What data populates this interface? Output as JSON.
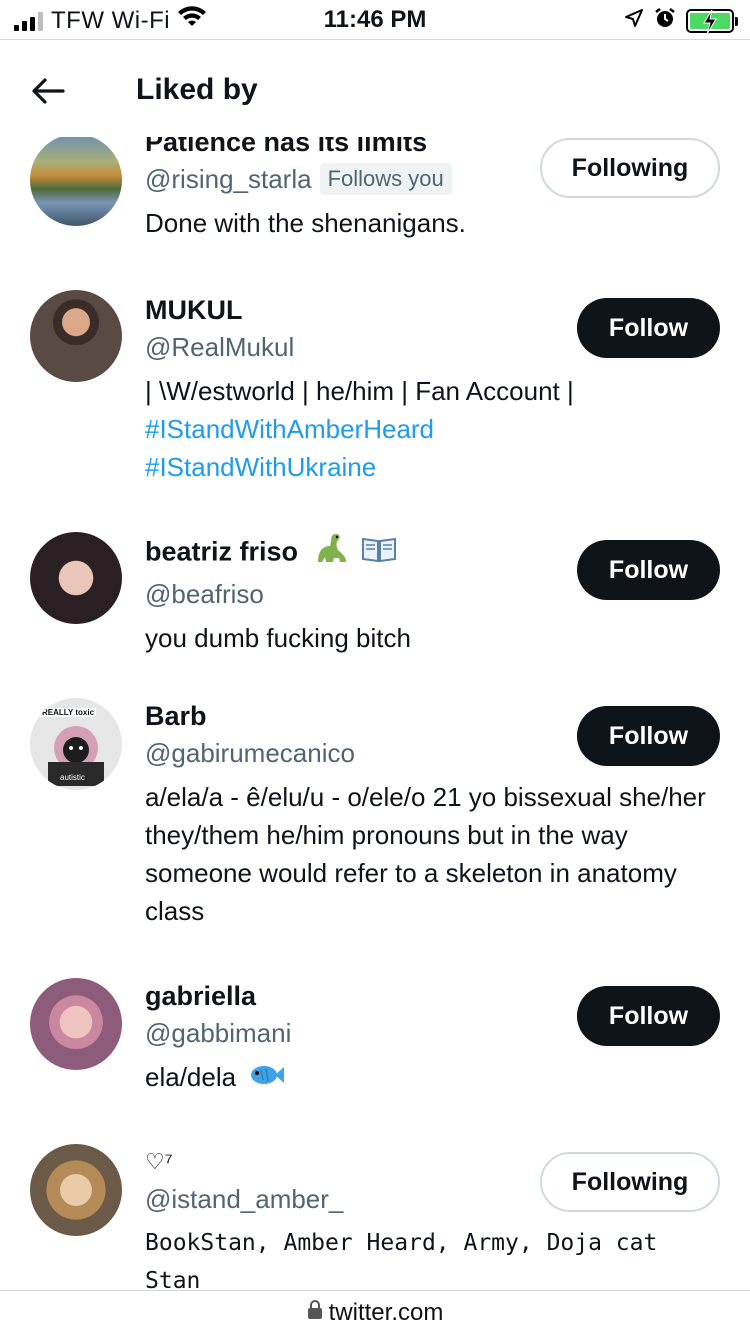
{
  "status_bar": {
    "carrier": "TFW Wi-Fi",
    "time": "11:46 PM"
  },
  "header": {
    "title": "Liked by"
  },
  "users": [
    {
      "name": "Patience has its limits",
      "handle": "@rising_starla",
      "badge": "Follows you",
      "bio": "Done with the shenanigans.",
      "button": "Following"
    },
    {
      "name": "MUKUL",
      "handle": "@RealMukul",
      "bio": "| \\W/estworld | he/him | Fan Account |",
      "tags": [
        "#IStandWithAmberHeard",
        "#IStandWithUkraine"
      ],
      "button": "Follow"
    },
    {
      "name": "beatriz friso",
      "handle": "@beafriso",
      "bio": "you dumb fucking bitch",
      "button": "Follow"
    },
    {
      "name": "Barb",
      "handle": "@gabirumecanico",
      "bio": "a/ela/a - ê/elu/u - o/ele/o 21 yo bissexual she/her they/them he/him pronouns but in the way someone would refer to a skeleton in anatomy class",
      "avatar_text": [
        "REALLY toxic",
        "autistic"
      ],
      "button": "Follow"
    },
    {
      "name": "gabriella",
      "handle": "@gabbimani",
      "bio": "ela/dela",
      "button": "Follow"
    },
    {
      "name": "♡⁷",
      "handle": "@istand_amber_",
      "bio": "BookStan, Amber Heard, Army, Doja cat Stan",
      "button": "Following"
    }
  ],
  "url_bar": {
    "url": "twitter.com"
  },
  "colors": {
    "link": "#1d9bf0",
    "follow_bg": "#0f1419",
    "secondary_text": "#536471",
    "battery": "#4cd964"
  }
}
